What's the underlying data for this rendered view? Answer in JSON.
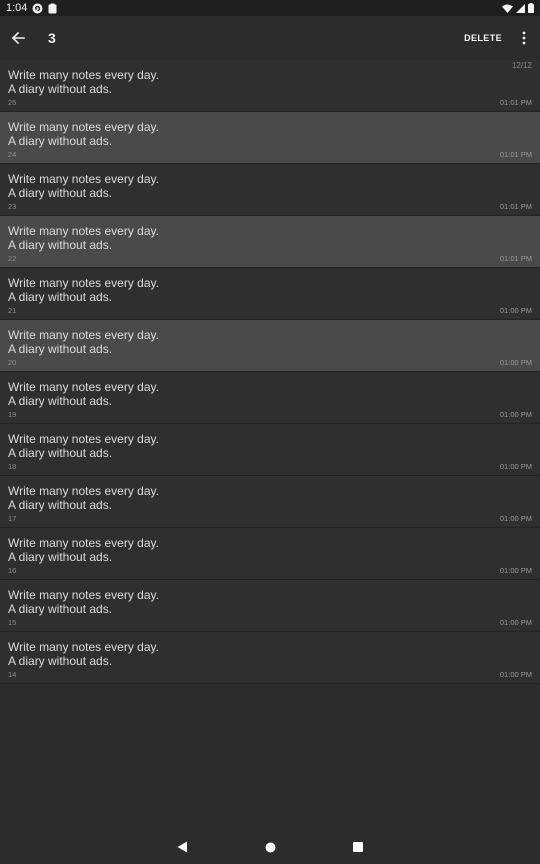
{
  "status_bar": {
    "time": "1:04",
    "icons_left": [
      "sync-icon",
      "clipboard-icon"
    ],
    "icons_right": [
      "wifi-icon",
      "signal-icon",
      "battery-icon"
    ]
  },
  "toolbar": {
    "selection_count": "3",
    "delete_label": "DELETE"
  },
  "counter": "12/12",
  "notes": [
    {
      "line1": "Write many notes  every day.",
      "line2": "A diary without ads.",
      "number": "25",
      "time": "01:01 PM",
      "selected": false
    },
    {
      "line1": "Write many notes  every day.",
      "line2": "A diary without ads.",
      "number": "24",
      "time": "01:01 PM",
      "selected": true
    },
    {
      "line1": "Write many notes  every day.",
      "line2": "A diary without ads.",
      "number": "23",
      "time": "01:01 PM",
      "selected": false
    },
    {
      "line1": "Write many notes  every day.",
      "line2": "A diary without ads.",
      "number": "22",
      "time": "01:01 PM",
      "selected": true
    },
    {
      "line1": "Write many notes  every day.",
      "line2": "A diary without ads.",
      "number": "21",
      "time": "01:00 PM",
      "selected": false
    },
    {
      "line1": "Write many notes  every day.",
      "line2": "A diary without ads.",
      "number": "20",
      "time": "01:00 PM",
      "selected": true
    },
    {
      "line1": "Write many notes  every day.",
      "line2": "A diary without ads.",
      "number": "19",
      "time": "01:00 PM",
      "selected": false
    },
    {
      "line1": "Write many notes  every day.",
      "line2": "A diary without ads.",
      "number": "18",
      "time": "01:00 PM",
      "selected": false
    },
    {
      "line1": "Write many notes  every day.",
      "line2": "A diary without ads.",
      "number": "17",
      "time": "01:00 PM",
      "selected": false
    },
    {
      "line1": "Write many notes  every day.",
      "line2": "A diary without ads.",
      "number": "16",
      "time": "01:00 PM",
      "selected": false
    },
    {
      "line1": "Write many notes  every day.",
      "line2": "A diary without ads.",
      "number": "15",
      "time": "01:00 PM",
      "selected": false
    },
    {
      "line1": "Write many notes  every day.",
      "line2": "A diary without ads.",
      "number": "14",
      "time": "01:00 PM",
      "selected": false
    }
  ],
  "nav_bar": {
    "buttons": [
      "back-triangle-icon",
      "home-circle-icon",
      "recents-square-icon"
    ]
  },
  "colors": {
    "background": "#2c2c2c",
    "item_background": "#2f2f2f",
    "selected_background": "#4a4a4a",
    "status_bar": "#1e1e1e"
  }
}
